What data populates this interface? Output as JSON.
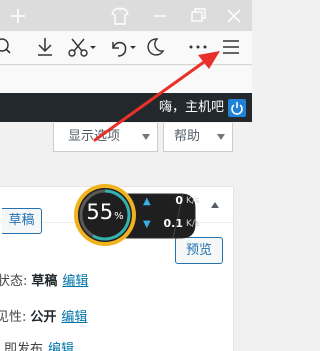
{
  "browser": {
    "icons": [
      "plus-icon",
      "shirt-icon",
      "minimize-icon",
      "restore-icon",
      "close-icon",
      "zoom-out-icon",
      "download-icon",
      "scissors-icon",
      "undo-icon",
      "moon-icon",
      "more-icon",
      "menu-icon"
    ]
  },
  "admin_bar": {
    "greeting": "嗨，主机吧"
  },
  "screen_meta": {
    "screen_options_label": "显示选项",
    "help_label": "帮助"
  },
  "publish_box": {
    "save_draft_label": "草稿",
    "preview_label": "预览",
    "status_label": "状态:",
    "status_value": "草稿",
    "status_edit": "编辑",
    "visibility_label": "见性:",
    "visibility_value": "公开",
    "visibility_edit": "编辑",
    "publish_label": "即发布",
    "publish_edit": "编辑"
  },
  "net_widget": {
    "percent": "55",
    "percent_unit": "%",
    "upload_value": "0",
    "upload_unit": "K/s",
    "download_value": "0.1",
    "download_unit": "K/s"
  },
  "colors": {
    "admin_bar": "#23282d",
    "annotation_arrow": "#e8302a",
    "link": "#0073aa",
    "widget_ring": "#f1b21f"
  }
}
